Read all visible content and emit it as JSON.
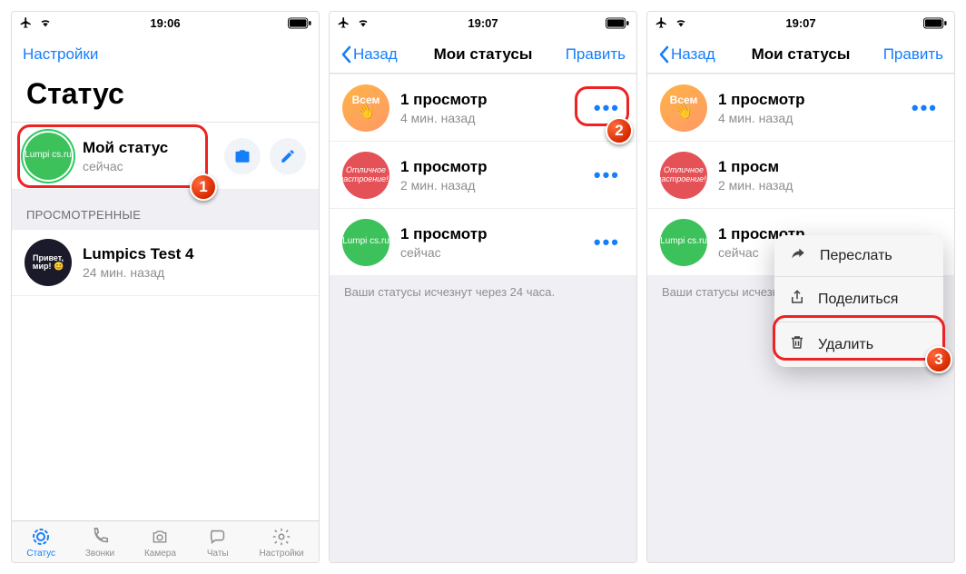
{
  "statusbar": {
    "time_a": "19:06",
    "time_b": "19:07",
    "time_c": "19:07"
  },
  "screenA": {
    "settings": "Настройки",
    "title": "Статус",
    "myStatus": {
      "title": "Мой статус",
      "sub": "сейчас",
      "avatar": "Lumpi\ncs.ru"
    },
    "viewedHeader": "ПРОСМОТРЕННЫЕ",
    "viewed": {
      "title": "Lumpics Test 4",
      "sub": "24 мин. назад",
      "avatar": "Привет,\nмир! 😊"
    },
    "tabs": {
      "status": "Статус",
      "calls": "Звонки",
      "camera": "Камера",
      "chats": "Чаты",
      "settings": "Настройки"
    }
  },
  "screenB": {
    "back": "Назад",
    "title": "Мои статусы",
    "edit": "Править",
    "rows": [
      {
        "avatar": "Всем",
        "avatarClass": "orange",
        "title": "1 просмотр",
        "sub": "4 мин. назад"
      },
      {
        "avatar": "Отличное настроение!!!",
        "avatarClass": "red",
        "title": "1 просмотр",
        "sub": "2 мин. назад"
      },
      {
        "avatar": "Lumpi\ncs.ru",
        "avatarClass": "green",
        "title": "1 просмотр",
        "sub": "сейчас"
      }
    ],
    "hint": "Ваши статусы исчезнут через 24 часа."
  },
  "screenC": {
    "back": "Назад",
    "title": "Мои статусы",
    "edit": "Править",
    "rows": [
      {
        "avatar": "Всем",
        "avatarClass": "orange",
        "title": "1 просмотр",
        "sub": "4 мин. назад"
      },
      {
        "avatar": "Отличное настроение!!!",
        "avatarClass": "red",
        "title": "1 просм",
        "sub": "2 мин. назад"
      },
      {
        "avatar": "Lumpi\ncs.ru",
        "avatarClass": "green",
        "title": "1 просмотр",
        "sub": "сейчас"
      }
    ],
    "hint": "Ваши статусы исчезнут через 24 часа.",
    "popover": {
      "forward": "Переслать",
      "share": "Поделиться",
      "delete": "Удалить"
    }
  },
  "callouts": {
    "one": "1",
    "two": "2",
    "three": "3"
  }
}
